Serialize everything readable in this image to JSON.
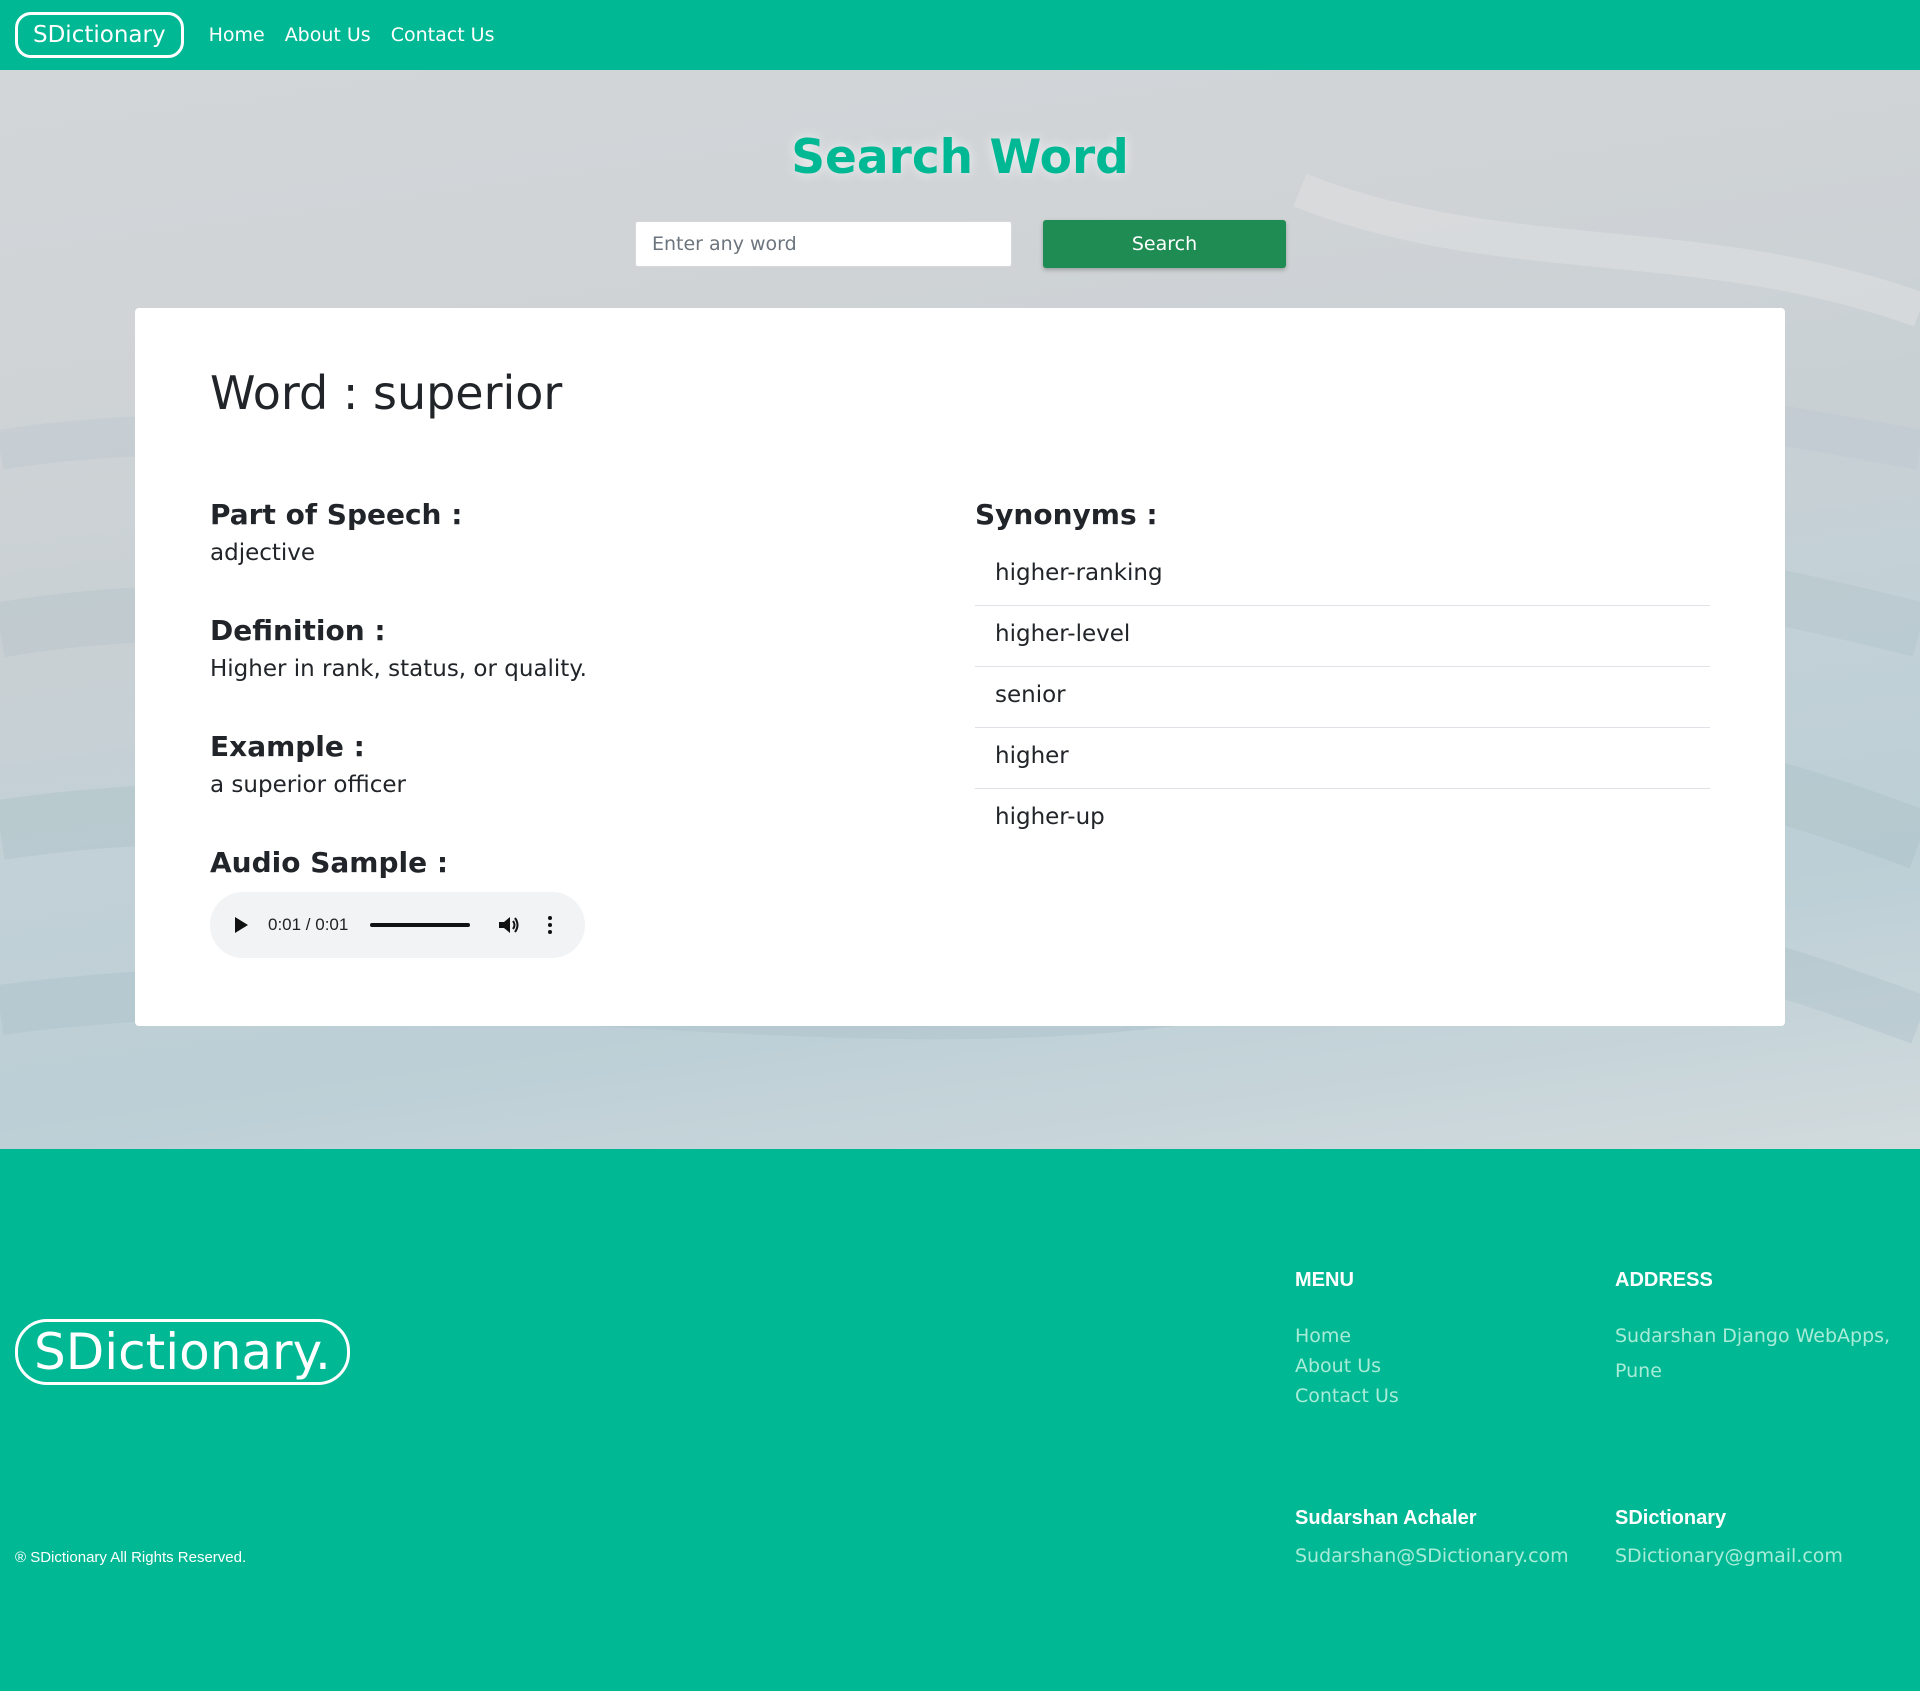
{
  "navbar": {
    "brand": "SDictionary",
    "links": [
      "Home",
      "About Us",
      "Contact Us"
    ]
  },
  "search": {
    "title": "Search Word",
    "placeholder": "Enter any word",
    "button_label": "Search"
  },
  "result": {
    "word_heading": "Word : superior",
    "part_of_speech_label": "Part of Speech :",
    "part_of_speech": "adjective",
    "definition_label": "Definition :",
    "definition": "Higher in rank, status, or quality.",
    "example_label": "Example :",
    "example": "a superior officer",
    "audio_label": "Audio Sample :",
    "audio_time": "0:01 / 0:01",
    "synonyms_label": "Synonyms :",
    "synonyms": [
      "higher-ranking",
      "higher-level",
      "senior",
      "higher",
      "higher-up"
    ]
  },
  "footer": {
    "logo": "SDictionary.",
    "menu_title": "MENU",
    "menu_links": [
      "Home",
      "About Us",
      "Contact Us"
    ],
    "address_title": "ADDRESS",
    "address_lines": [
      "Sudarshan Django WebApps,",
      "Pune"
    ],
    "contact_name": "Sudarshan Achaler",
    "contact_email": "Sudarshan@SDictionary.com",
    "site_name": "SDictionary",
    "site_email": "SDictionary@gmail.com",
    "copyright": "® SDictionary All Rights Reserved."
  },
  "colors": {
    "brand_green": "#00b894",
    "button_green": "#1e8c53",
    "footer_link": "#a8ecd8"
  }
}
